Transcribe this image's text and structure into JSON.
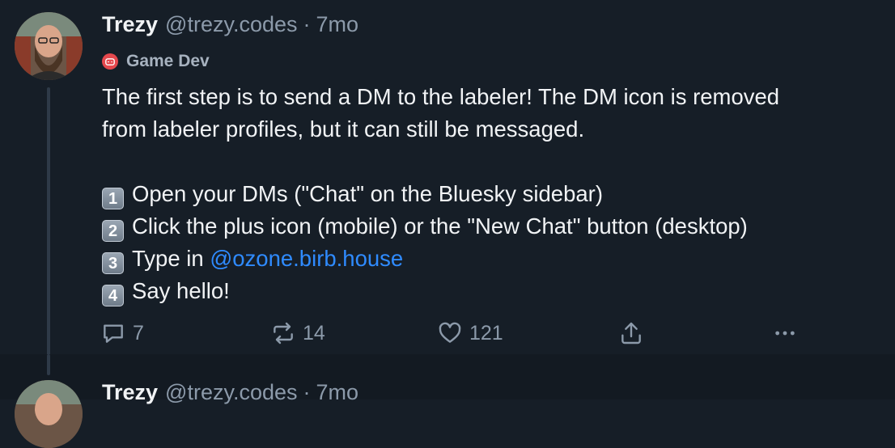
{
  "post": {
    "author": {
      "name": "Trezy",
      "handle": "@trezy.codes",
      "separator": "·",
      "time": "7mo"
    },
    "feed": {
      "icon": "gamepad-icon",
      "label": "Game Dev",
      "color": "#e5484d"
    },
    "body": {
      "line1": "The first step is to send a DM to the labeler! The DM icon is removed",
      "line2": "from labeler profiles, but it can still be messaged.",
      "steps": [
        {
          "key": "1",
          "text": "Open your DMs (\"Chat\" on the Bluesky sidebar)"
        },
        {
          "key": "2",
          "text": "Click the plus icon (mobile) or the \"New Chat\" button (desktop)"
        },
        {
          "key": "3",
          "text": "Type in ",
          "mention": "@ozone.birb.house"
        },
        {
          "key": "4",
          "text": "Say hello!"
        }
      ]
    },
    "actions": {
      "reply_count": "7",
      "repost_count": "14",
      "like_count": "121"
    }
  },
  "next_post": {
    "author": {
      "name": "Trezy",
      "handle": "@trezy.codes",
      "separator": "·",
      "time": "7mo"
    }
  },
  "colors": {
    "background": "#161e27",
    "text": "#f1f3f5",
    "muted": "#8c9aaa",
    "link": "#2f8bff"
  }
}
